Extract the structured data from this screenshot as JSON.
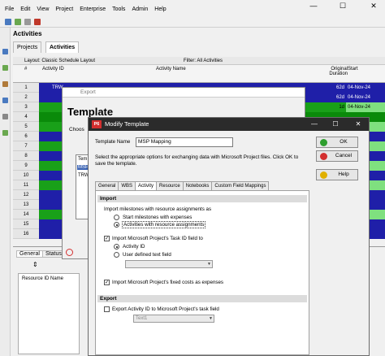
{
  "menu": [
    "File",
    "Edit",
    "View",
    "Project",
    "Enterprise",
    "Tools",
    "Admin",
    "Help"
  ],
  "window_buttons": {
    "minimize": "—",
    "maximize": "☐",
    "close": "✕"
  },
  "activities_title": "Activities",
  "tabs": [
    {
      "label": "Projects"
    },
    {
      "label": "Activities"
    }
  ],
  "layout_label": "Layout: Classic Schedule Layout",
  "filter_label": "Filter: All Activities",
  "grid": {
    "col_num": "#",
    "col_activity_id": "Activity ID",
    "col_activity_name": "Activity Name",
    "col_duration": "Original Duration",
    "col_start": "Start",
    "rows": [
      {
        "n": "1",
        "id": "TRW",
        "dur": "62d",
        "start": "04-Nov-24",
        "color": "#1f1fa8"
      },
      {
        "n": "2",
        "id": "",
        "dur": "62d",
        "start": "04-Nov-24",
        "color": "#1f1fa8"
      },
      {
        "n": "3",
        "id": "",
        "dur": "1d",
        "start": "04-Nov-24",
        "color": "#19a019"
      },
      {
        "n": "4",
        "id": "",
        "dur": "",
        "start": "",
        "color": "#0a8a0a"
      },
      {
        "n": "5",
        "id": "",
        "dur": "",
        "start": "",
        "color": "#19a019"
      },
      {
        "n": "6",
        "id": "",
        "dur": "",
        "start": "",
        "color": "#1f1fa8"
      },
      {
        "n": "7",
        "id": "",
        "dur": "",
        "start": "",
        "color": "#19a019"
      },
      {
        "n": "8",
        "id": "",
        "dur": "",
        "start": "",
        "color": "#1f1fa8"
      },
      {
        "n": "9",
        "id": "",
        "dur": "",
        "start": "",
        "color": "#19a019"
      },
      {
        "n": "10",
        "id": "",
        "dur": "",
        "start": "",
        "color": "#1f1fa8"
      },
      {
        "n": "11",
        "id": "",
        "dur": "",
        "start": "",
        "color": "#19a019"
      },
      {
        "n": "12",
        "id": "",
        "dur": "",
        "start": "",
        "color": "#1f1fa8"
      },
      {
        "n": "13",
        "id": "",
        "dur": "",
        "start": "",
        "color": "#1f1fa8"
      },
      {
        "n": "14",
        "id": "",
        "dur": "",
        "start": "",
        "color": "#19a019"
      },
      {
        "n": "15",
        "id": "",
        "dur": "",
        "start": "",
        "color": "#1f1fa8"
      },
      {
        "n": "16",
        "id": "",
        "dur": "",
        "start": "",
        "color": "#1f1fa8"
      }
    ]
  },
  "bottom_pane": {
    "tabs": [
      "General",
      "Status"
    ],
    "col_resource_id": "Resource ID Name"
  },
  "export_dialog": {
    "title": "Export",
    "heading": "Template",
    "choose_label": "Choos",
    "list_header": "Tem",
    "list_items": [
      "MSP",
      "TRW"
    ]
  },
  "dialog": {
    "title": "Modify Template",
    "logo": "P6",
    "template_name_label": "Template Name",
    "template_name_value": "MSP Mapping",
    "instructions": "Select the appropriate options for exchanging data with Microsoft Project files. Click OK to save the template.",
    "buttons": {
      "ok": "OK",
      "cancel": "Cancel",
      "help": "Help"
    },
    "tabs": [
      {
        "label": "General"
      },
      {
        "label": "WBS"
      },
      {
        "label": "Activity"
      },
      {
        "label": "Resource"
      },
      {
        "label": "Notebooks"
      },
      {
        "label": "Custom Field Mappings"
      }
    ],
    "import": {
      "section_label": "Import",
      "milestones_label": "Import milestones with resource assignments as",
      "opt_start_milestones": "Start milestones with expenses",
      "opt_activities_resources": "Activities with resource assignments",
      "task_id_label": "Import Microsoft Project's Task ID field to",
      "opt_activity_id": "Activity ID",
      "opt_user_text": "User defined text field",
      "fixed_costs_label": "Import Microsoft Project's fixed costs as expenses"
    },
    "export": {
      "section_label": "Export",
      "export_id_label": "Export Activity ID to Microsoft Project's task field",
      "task_field_value": "Text1"
    }
  },
  "colors": {
    "title_bg": "#2b2b2b",
    "ok_icon": "#2e9e2e",
    "cancel_icon": "#d32f2f",
    "help_icon": "#e0b000"
  }
}
